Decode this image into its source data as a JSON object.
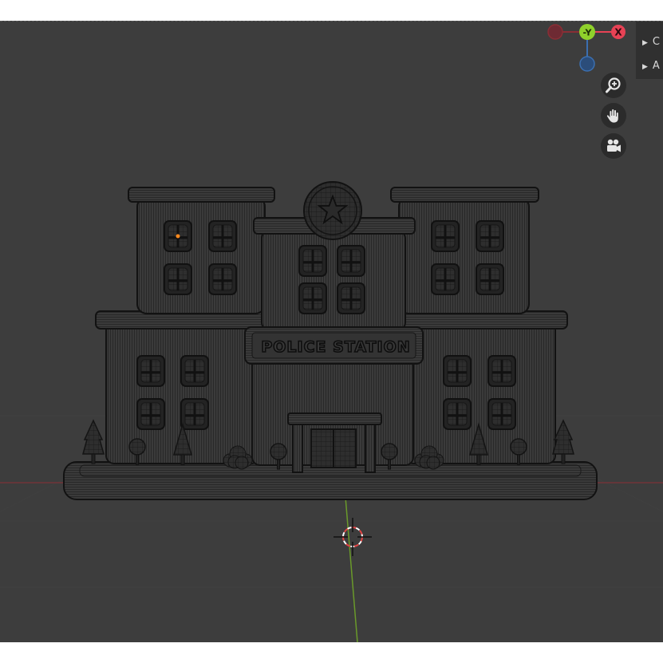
{
  "axis_gizmo": {
    "neg_x_label": "",
    "pos_y_label": "-Y",
    "pos_x_label": "X",
    "z_label": ""
  },
  "nav_gizmo": {
    "zoom_icon": "zoom-magnifier-icon",
    "pan_icon": "hand-pan-icon",
    "camera_icon": "camera-view-icon"
  },
  "side_panel": {
    "items": [
      {
        "label": "C"
      },
      {
        "label": "A"
      }
    ]
  },
  "scene": {
    "sign_text": "POLICE STATION",
    "colors": {
      "background": "#3d3d3d",
      "wire": "#141414",
      "x_axis": "#8a2e35",
      "y_axis": "#6a9a2a",
      "gizmo_x": "#e84255",
      "gizmo_y": "#8fd12b",
      "gizmo_z": "#3b6fb0"
    }
  }
}
